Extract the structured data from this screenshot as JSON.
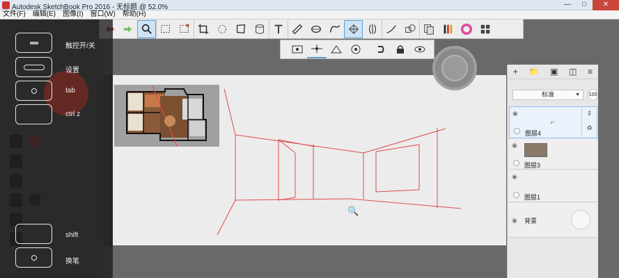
{
  "window": {
    "title": "Autodesk SketchBook Pro 2016 - 无标题 @ 52.0%",
    "minimize": "—",
    "maximize": "□",
    "close": "✕"
  },
  "menu": [
    "文件(F)",
    "编辑(E)",
    "图像(I)",
    "窗口(W)",
    "帮助(H)"
  ],
  "toolbar": {
    "tools": [
      "undo",
      "redo",
      "zoom",
      "select-rect",
      "select-lasso",
      "crop",
      "transform",
      "distort",
      "fill-bucket",
      "text",
      "ruler",
      "ellipse",
      "french-curve",
      "perspective",
      "symmetry",
      "stroke",
      "shape",
      "copy-paste",
      "brush-library",
      "color-wheel",
      "library-grid"
    ],
    "active": "perspective",
    "brush_library_colors": [
      "#222222",
      "#c0392b",
      "#e0a020"
    ],
    "color_wheel": "#e14da1"
  },
  "subtoolbar": {
    "tools": [
      "vanish-1",
      "vanish-2",
      "vanish-3",
      "fisheye",
      "snap-magnet",
      "lock",
      "eye"
    ],
    "active": "vanish-2"
  },
  "overlay_keys": [
    {
      "label": "触控开/关"
    },
    {
      "label": "设置"
    },
    {
      "label": "tab"
    },
    {
      "label": "ctrl z"
    },
    {
      "label": "shift"
    },
    {
      "label": "换笔"
    }
  ],
  "layers": {
    "blend_mode": "标准",
    "opacity": "100",
    "items": [
      {
        "name": "图层4",
        "selected": true
      },
      {
        "name": "图层3",
        "selected": false
      },
      {
        "name": "图层1",
        "selected": false
      },
      {
        "name": "背景",
        "selected": false
      }
    ]
  },
  "colors": {
    "sketch_lines": "#e04a4a",
    "accent": "#5a9fd6",
    "close_button": "#c9463d"
  }
}
